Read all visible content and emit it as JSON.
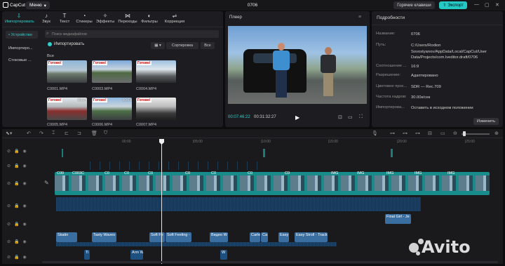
{
  "titlebar": {
    "app_name": "CapCut",
    "menu_label": "Меню",
    "project_name": "0706",
    "hotkeys_label": "Горячие клавиши",
    "export_label": "Экспорт"
  },
  "media_tabs": [
    {
      "label": "Импортировать",
      "icon": "import-icon",
      "active": true
    },
    {
      "label": "Звук",
      "icon": "music-icon"
    },
    {
      "label": "Текст",
      "icon": "text-icon"
    },
    {
      "label": "Стикеры",
      "icon": "sticker-icon"
    },
    {
      "label": "Эффекты",
      "icon": "effects-icon"
    },
    {
      "label": "Переходы",
      "icon": "transition-icon"
    },
    {
      "label": "Фильтры",
      "icon": "filter-icon"
    },
    {
      "label": "Коррекция",
      "icon": "adjust-icon"
    }
  ],
  "sidebar": {
    "items": [
      "• Устройство",
      "Импортиро...",
      "Стоковые ..."
    ]
  },
  "media": {
    "search_placeholder": "Поиск медиафайлов",
    "import_label": "Импортировать",
    "sort_label": "Сортировка",
    "filter_label": "Все",
    "all_label": "Все",
    "thumbs": [
      {
        "name": "C0001.MP4",
        "badge": "Готово!",
        "duration": ""
      },
      {
        "name": "C0003.MP4",
        "badge": "Готово!",
        "duration": ""
      },
      {
        "name": "C0004.MP4",
        "badge": "Готово!",
        "duration": ""
      },
      {
        "name": "C0005.MP4",
        "badge": "Готово!",
        "duration": "00:34"
      },
      {
        "name": "C0006.MP4",
        "badge": "Готово!",
        "duration": "00:09"
      },
      {
        "name": "C0007.MP4",
        "badge": "Готово!",
        "duration": ""
      }
    ]
  },
  "player": {
    "title": "Плеер",
    "current_time": "00:07:46:22",
    "total_time": "00:31:32:27"
  },
  "details": {
    "title": "Подробности",
    "rows": [
      {
        "key": "Название:",
        "value": "0706"
      },
      {
        "key": "Путь:",
        "value": "C:/Users/Rodion Sovostyanov/AppData/Local/CapCut/User Data/Projects/com.lveditor.draft/0706"
      },
      {
        "key": "Соотношение ...",
        "value": "16:9"
      },
      {
        "key": "Разрешение:",
        "value": "Адаптировано"
      },
      {
        "key": "Цветовое прос...",
        "value": "SDR — Rec.709"
      },
      {
        "key": "Частота кадров:",
        "value": "30.00к/сек"
      },
      {
        "key": "Импортирова...",
        "value": "Оставить в исходном положении"
      }
    ],
    "change_label": "Изменить"
  },
  "timeline": {
    "ruler": [
      "00:00",
      "|05:00",
      "|10:00",
      "|15:00",
      "|20:00",
      "|25:00",
      "|30:00"
    ],
    "video_clips": [
      "C00",
      "C003C",
      "C0",
      "C0",
      "C0",
      "C0",
      "C0",
      "C0",
      "C0",
      "IMG",
      "IMG",
      "IMG",
      "IMG",
      "IMG"
    ],
    "music_clips": [
      {
        "label": "Skatin"
      },
      {
        "label": "Tasty Waves -"
      },
      {
        "label": "Soft Fe"
      },
      {
        "label": "Soft Feeling -"
      },
      {
        "label": "Видео W"
      },
      {
        "label": "Carle"
      },
      {
        "label": "Ca"
      },
      {
        "label": "Easy"
      },
      {
        "label": "Easy Stroll - TrackTr"
      },
      {
        "label": "Final Girl - Je"
      }
    ],
    "small_clips": [
      "Ti",
      "Arm W",
      "W"
    ]
  },
  "watermark": "Avito"
}
